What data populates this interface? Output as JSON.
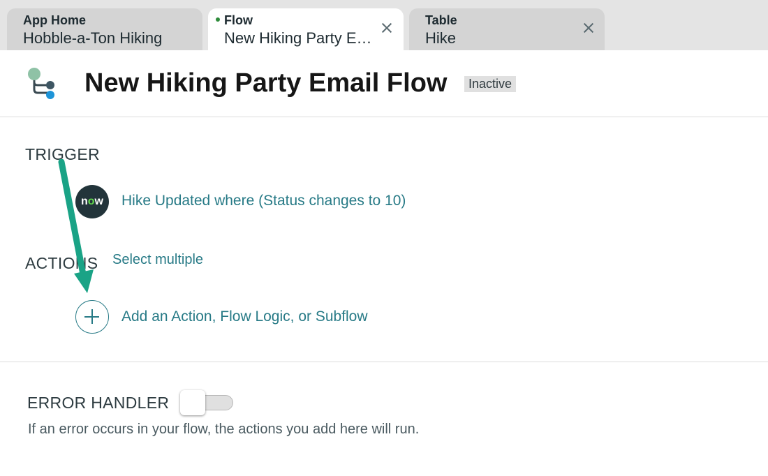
{
  "tabs": [
    {
      "type": "App Home",
      "name": "Hobble-a-Ton Hiking",
      "active": false,
      "closable": false
    },
    {
      "type": "Flow",
      "name": "New Hiking Party Em...",
      "active": true,
      "closable": true
    },
    {
      "type": "Table",
      "name": "Hike",
      "active": false,
      "closable": true
    }
  ],
  "header": {
    "title": "New Hiking Party Email Flow",
    "status": "Inactive",
    "icon": "flow-icon"
  },
  "trigger": {
    "label": "TRIGGER",
    "logo_text_pre": "n",
    "logo_text_o": "o",
    "logo_text_post": "w",
    "description": "Hike Updated where (Status changes to 10)"
  },
  "actions": {
    "label": "ACTIONS",
    "select_multiple": "Select multiple",
    "add_label": "Add an Action, Flow Logic, or Subflow"
  },
  "error_handler": {
    "label": "ERROR HANDLER",
    "enabled": false,
    "description": "If an error occurs in your flow, the actions you add here will run."
  },
  "colors": {
    "link": "#277a86",
    "annotation_arrow": "#1aa386",
    "now_green": "#62d84e"
  }
}
